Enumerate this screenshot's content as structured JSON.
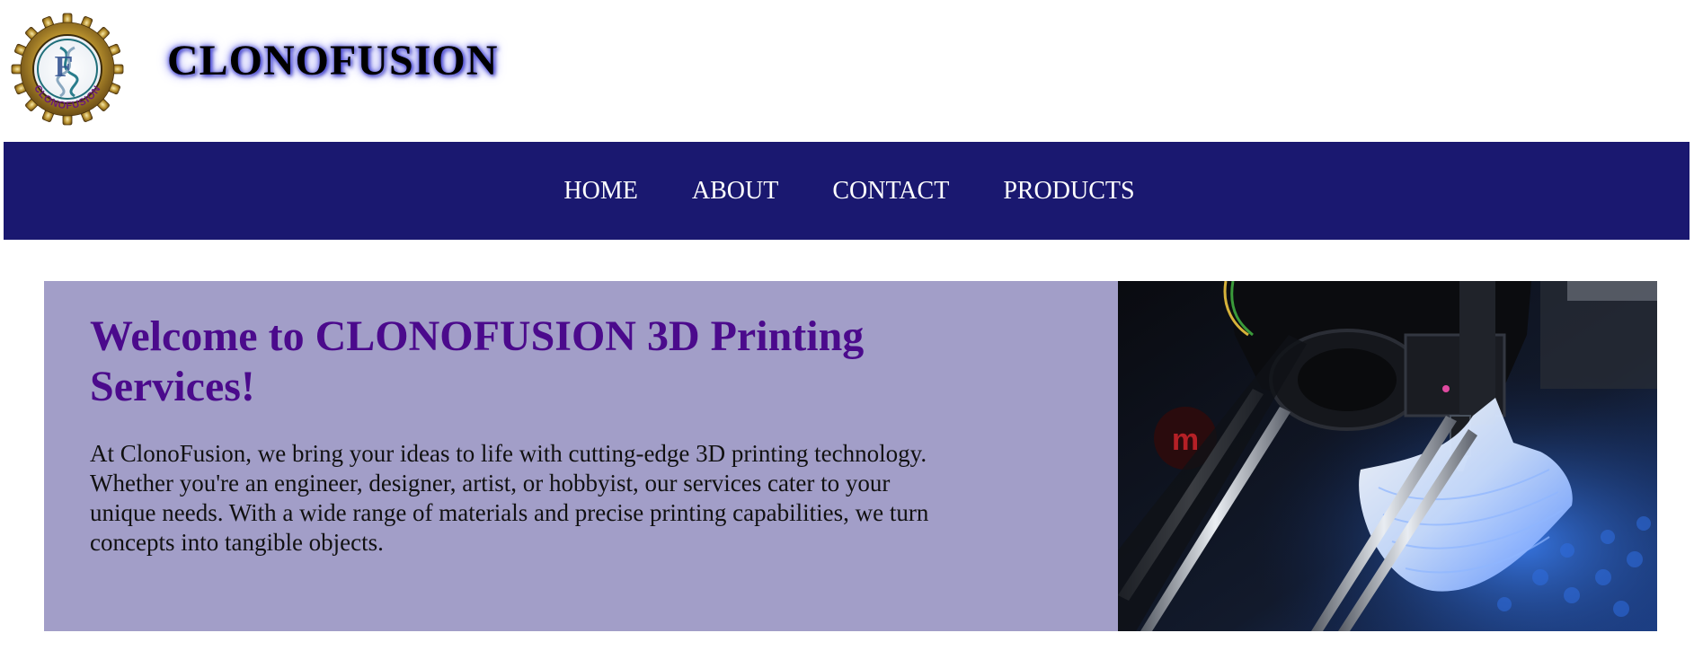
{
  "header": {
    "logo_text": "CLONOFUSION",
    "brand": "CLONOFUSION"
  },
  "nav": {
    "items": [
      {
        "label": "HOME"
      },
      {
        "label": "ABOUT"
      },
      {
        "label": "CONTACT"
      },
      {
        "label": "PRODUCTS"
      }
    ]
  },
  "hero": {
    "title": "Welcome to CLONOFUSION 3D Printing Services!",
    "description": "At ClonoFusion, we bring your ideas to life with cutting-edge 3D printing technology. Whether you're an engineer, designer, artist, or hobbyist, our services cater to your unique needs. With a wide range of materials and precise printing capabilities, we turn concepts into tangible objects."
  },
  "colors": {
    "nav_background": "#1a1870",
    "hero_panel": "#a29ec8",
    "hero_title": "#4b0a8c",
    "brand_glow": "#4b4bd6"
  },
  "icons": {
    "logo": "gear-dna-logo",
    "hero_image": "3d-printer-photo"
  }
}
